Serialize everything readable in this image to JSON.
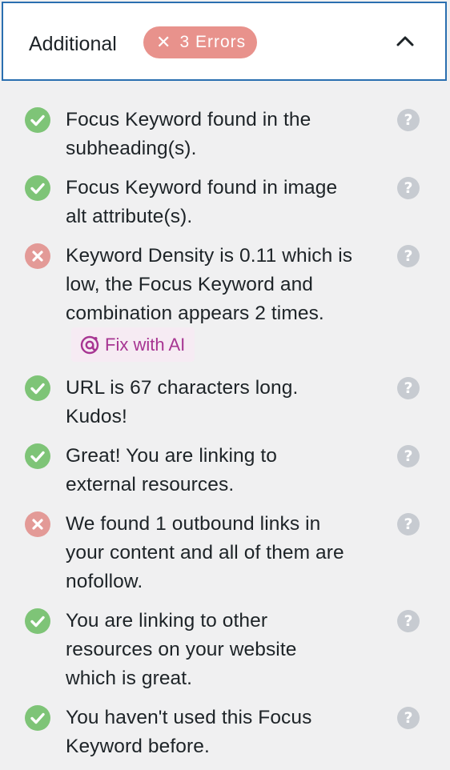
{
  "header": {
    "title": "Additional",
    "badge_icon": "close-icon",
    "badge_label": "3 Errors",
    "badge_color": "#e8928c",
    "toggle_icon": "chevron-up-icon"
  },
  "colors": {
    "pass": "#7ec477",
    "fail": "#e39a97",
    "help": "#c7cbd1",
    "accent_border": "#2a6fb0",
    "ai_text": "#a73592",
    "ai_bg": "#f6ebf3"
  },
  "checks": [
    {
      "status": "pass",
      "lines": [
        "Focus Keyword found in the",
        "subheading(s)."
      ]
    },
    {
      "status": "pass",
      "lines": [
        "Focus Keyword found in image",
        "alt attribute(s)."
      ]
    },
    {
      "status": "fail",
      "lines": [
        "Keyword Density is 0.11 which is",
        "low, the Focus Keyword and",
        "combination appears 2 times."
      ],
      "action": "Fix with AI"
    },
    {
      "status": "pass",
      "lines": [
        "URL is 67 characters long.",
        "Kudos!"
      ]
    },
    {
      "status": "pass",
      "lines": [
        "Great! You are linking to",
        "external resources."
      ]
    },
    {
      "status": "fail",
      "lines": [
        "We found 1 outbound links in",
        "your content and all of them are",
        "nofollow."
      ]
    },
    {
      "status": "pass",
      "lines": [
        "You are linking to other",
        "resources on your website",
        "which is great."
      ]
    },
    {
      "status": "pass",
      "lines": [
        "You haven't used this Focus",
        "Keyword before."
      ]
    }
  ],
  "help_icon": "question-mark-icon",
  "help_glyph": "?"
}
